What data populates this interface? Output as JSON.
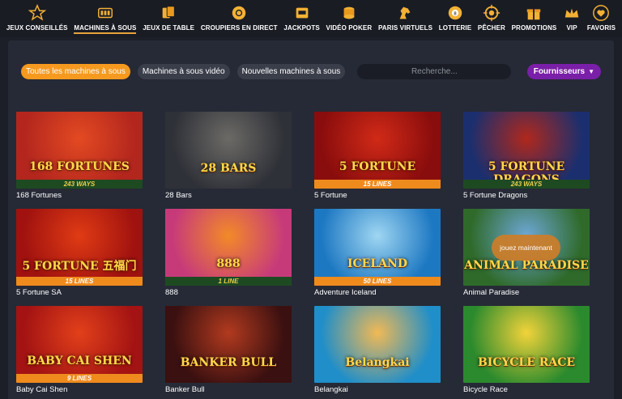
{
  "nav": {
    "items": [
      {
        "label": "JEUX CONSEILLÉS",
        "icon": "star-icon",
        "active": false
      },
      {
        "label": "MACHINES À SOUS",
        "icon": "slot-machine-icon",
        "active": true
      },
      {
        "label": "JEUX DE TABLE",
        "icon": "cards-icon",
        "active": false
      },
      {
        "label": "CROUPIERS EN DIRECT",
        "icon": "chip-icon",
        "active": false
      },
      {
        "label": "JACKPOTS",
        "icon": "jackpot-icon",
        "active": false
      },
      {
        "label": "VIDÉO POKER",
        "icon": "coins-icon",
        "active": false
      },
      {
        "label": "PARIS VIRTUELS",
        "icon": "horse-icon",
        "active": false
      },
      {
        "label": "LOTTERIE",
        "icon": "lottery-ball-icon",
        "active": false
      },
      {
        "label": "PÊCHER",
        "icon": "target-icon",
        "active": false
      },
      {
        "label": "PROMOTIONS",
        "icon": "gift-icon",
        "active": false
      },
      {
        "label": "VIP",
        "icon": "crown-icon",
        "active": false
      },
      {
        "label": "FAVORIS",
        "icon": "heart-icon",
        "active": false
      }
    ]
  },
  "filters": {
    "all_slots": "Toutes les machines à sous",
    "video_slots": "Machines à sous vidéo",
    "new_slots": "Nouvelles machines à sous",
    "search_placeholder": "Recherche...",
    "providers": "Fournisseurs"
  },
  "games": [
    {
      "title": "168 Fortunes",
      "logo": "168 FORTUNES",
      "ribbon": "243 WAYS",
      "ribbon_style": "green",
      "bg": "#b3261e",
      "bg2": "#e34a22"
    },
    {
      "title": "28 Bars",
      "logo": "28 BARS",
      "ribbon": "",
      "ribbon_style": "",
      "bg": "#2f3138",
      "bg2": "#6c6a66"
    },
    {
      "title": "5 Fortune",
      "logo": "5 FORTUNE",
      "ribbon": "15 LINES",
      "ribbon_style": "orange",
      "bg": "#8a0d0d",
      "bg2": "#d12a17"
    },
    {
      "title": "5 Fortune Dragons",
      "logo": "5 FORTUNE DRAGONS",
      "ribbon": "243 WAYS",
      "ribbon_style": "green",
      "bg": "#1b2f6e",
      "bg2": "#b0281c"
    },
    {
      "title": "5 Fortune SA",
      "logo": "5 FORTUNE 五福门",
      "ribbon": "15 LINES",
      "ribbon_style": "orange",
      "bg": "#a0120f",
      "bg2": "#e03b14"
    },
    {
      "title": "888",
      "logo": "888",
      "ribbon": "1 LINE",
      "ribbon_style": "green",
      "bg": "#c73a7a",
      "bg2": "#f28a28"
    },
    {
      "title": "Adventure Iceland",
      "logo": "ICELAND",
      "ribbon": "50 LINES",
      "ribbon_style": "orange",
      "bg": "#1d78c2",
      "bg2": "#9fd6f2"
    },
    {
      "title": "Animal Paradise",
      "logo": "ANIMAL PARADISE",
      "ribbon": "",
      "ribbon_style": "",
      "bg": "#2f6a2a",
      "bg2": "#6da7d6",
      "play": "jouez maintenant"
    },
    {
      "title": "Baby Cai Shen",
      "logo": "BABY CAI SHEN",
      "ribbon": "9 LINES",
      "ribbon_style": "orange",
      "bg": "#a31313",
      "bg2": "#e2401a"
    },
    {
      "title": "Banker Bull",
      "logo": "BANKER BULL",
      "ribbon": "",
      "ribbon_style": "",
      "bg": "#3a1010",
      "bg2": "#b23a1f"
    },
    {
      "title": "Belangkai",
      "logo": "Belangkai",
      "ribbon": "",
      "ribbon_style": "",
      "bg": "#1f8ec9",
      "bg2": "#f1b955"
    },
    {
      "title": "Bicycle Race",
      "logo": "BICYCLE RACE",
      "ribbon": "",
      "ribbon_style": "",
      "bg": "#2b8a2d",
      "bg2": "#f2d33a"
    }
  ]
}
